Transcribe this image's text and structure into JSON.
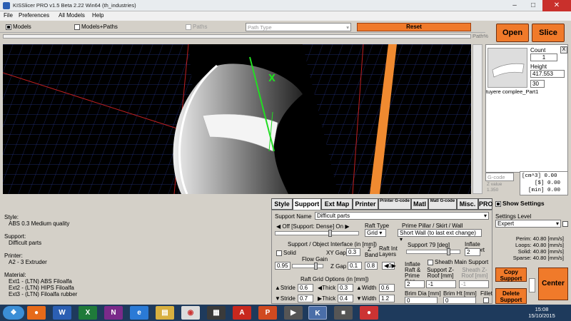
{
  "window": {
    "title": "KISSlicer PRO v1.5 Beta 2.22 Win64 (th_industries)"
  },
  "menu": [
    "File",
    "Preferences",
    "All Models",
    "Help"
  ],
  "filterbar": {
    "models": "Models",
    "models_paths": "Models+Paths",
    "paths": "Paths",
    "path_type": "Path Type",
    "reset": "Reset",
    "path_pct": "Path%"
  },
  "actions": {
    "open": "Open",
    "slice": "Slice"
  },
  "viewport": {
    "axis_label": "X"
  },
  "part": {
    "count_label": "Count",
    "count": "1",
    "height_label": "Height",
    "height": "417.553",
    "scale": "30",
    "name": "tuyere complee_Part1",
    "close": "X"
  },
  "gcode": {
    "combo": "G-code",
    "z_value_label": "Z value",
    "z_value": "1.350",
    "vol_unit": "[cm^3]",
    "vol": "0.00",
    "cost_unit": "[$]",
    "cost": "0.00",
    "time_unit": "[min]",
    "time": "0.00"
  },
  "tabs": [
    "Style",
    "Support",
    "Ext Map",
    "Printer",
    "Printer G-code",
    "Matl",
    "Matl G-code",
    "Misc.",
    "PRO"
  ],
  "info": {
    "style_h": "Style:",
    "style": "ABS 0.3 Medium quality",
    "support_h": "Support:",
    "support": "Difficult parts",
    "printer_h": "Printer:",
    "printer": "A2 - 3 Extruder",
    "material_h": "Material:",
    "ext1": "Ext1 - (LTN) ABS Filoalfa",
    "ext2": "Ext2 - (LTN) HIPS Filoalfa",
    "ext3": "Ext3 - (LTN) Filoalfa rubber"
  },
  "support": {
    "name_label": "Support Name",
    "name": "Difficult parts",
    "density": "Off [Support: Dense] On",
    "raft_type_label": "Raft Type",
    "raft_type": "Grid",
    "prime_label": "Prime Pillar / Skirt / Wall",
    "prime": "Short Wall (to last ext change)",
    "interface_label": "Support / Object Interface (in [mm])",
    "solid": "Solid",
    "xy_gap_label": "XY Gap",
    "xy_gap": "0.3",
    "z_label": "Z",
    "band_label": "Band",
    "band": "0.8",
    "raft_int_label": "Raft Int Layers",
    "raft_int": "0",
    "flow_gain_label": "Flow Gain",
    "flow_gain": "0.95",
    "z_gap_label": "Z Gap",
    "z_gap": "0.1",
    "angle_label": "Support 79 [deg]",
    "inflate_label": "Inflate Support",
    "inflate": "2",
    "sheath": "Sheath Main Support",
    "inflate_raft_label": "Inflate Raft & Prime Gap",
    "inflate_raft": "2",
    "z_roof_label": "Support Z-Roof [mm]",
    "z_roof": "-1",
    "sheath_roof_label": "Sheath Z-Roof [mm]",
    "sheath_roof": "-1",
    "raft_grid_label": "Raft Grid Options (in [mm])",
    "stride_label": "Stride",
    "stride1": "0.6",
    "stride2": "0.7",
    "thick_label": "Thick",
    "thick1": "0.3",
    "thick2": "0.4",
    "width_label": "Width",
    "width1": "0.6",
    "width2": "1.2",
    "brim_dia_label": "Brim Dia [mm]",
    "brim_dia": "0",
    "brim_ht_label": "Brim Ht [mm]",
    "brim_ht": "0",
    "fillet_label": "Fillet"
  },
  "right": {
    "show_settings": "Show Settings",
    "level_label": "Settings Level",
    "level": "Expert",
    "perim": "Perim:  40.80 [mm/s]",
    "loops": "Loops:  40.80 [mm/s]",
    "solid": "Solid:  40.80 [mm/s]",
    "sparse": "Sparse:  40.80 [mm/s]",
    "copy_support": "Copy Support",
    "delete_support": "Delete Support",
    "center": "Center"
  },
  "taskbar": {
    "time": "15:08",
    "date": "15/10/2015"
  },
  "colors": {
    "accent": "#f07a2a",
    "grid": "#3a4fb0",
    "axis_x": "#22dd22",
    "taskbar": "#1e3a5c"
  }
}
